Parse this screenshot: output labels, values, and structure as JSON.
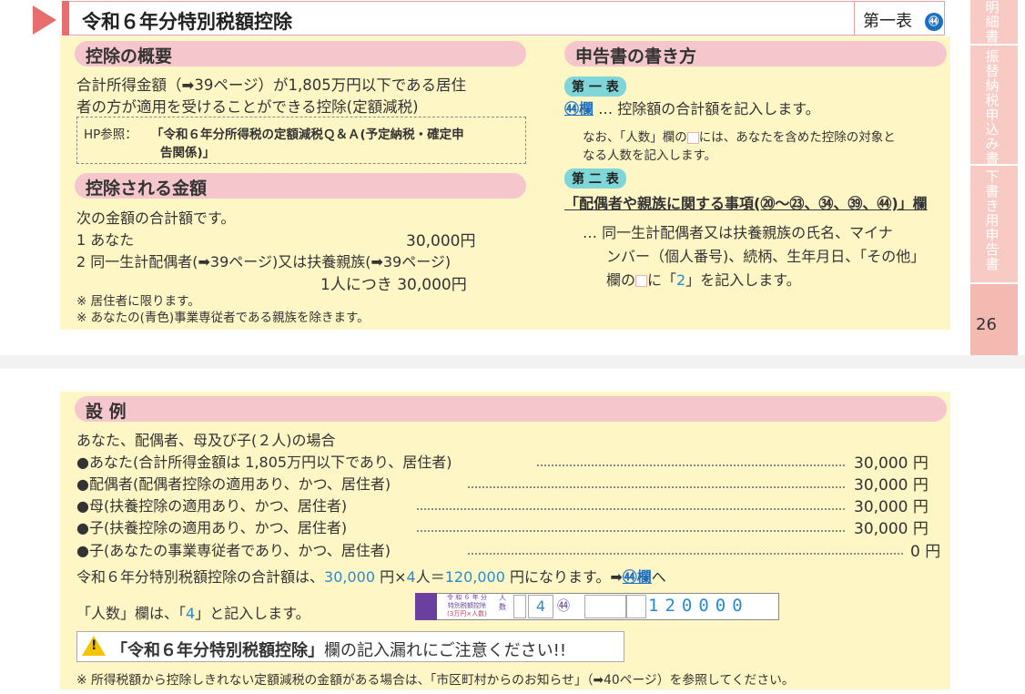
{
  "top": {
    "title": "令和６年分特別税額控除",
    "title_right": "第一表",
    "title_right_num": "㊹",
    "left": {
      "heading1": "控除の概要",
      "desc_line1": "合計所得金額（➡39ページ）が1,805万円以下である居住",
      "desc_line2": "者の方が適用を受けることができる控除(定額減税)",
      "hp_prefix": "HP参照：",
      "hp_title_line1": "「令和６年分所得税の定額減税Ｑ＆Ａ(予定納税・確定申",
      "hp_title_line2": "告関係)」",
      "heading2": "控除される金額",
      "amount_intro": "次の金額の合計額です。",
      "item1_label": "1  あなた",
      "item1_value": "30,000円",
      "item2_label": "2  同一生計配偶者(➡39ページ)又は扶養親族(➡39ページ)",
      "item2_value": "1人につき  30,000円",
      "note1": "※ 居住者に限ります。",
      "note2": "※ あなたの(青色)事業専従者である親族を除きます。"
    },
    "right": {
      "heading": "申告書の書き方",
      "badge1": "第 一 表",
      "line1_num": "㊹欄",
      "line1_text": "… 控除額の合計額を記入します。",
      "line2": "なお、「人数」欄の",
      "line2b": "には、あなたを含めた控除の対象と",
      "line3": "なる人数を記入します。",
      "badge2": "第 二 表",
      "line4": "「配偶者や親族に関する事項(⑳～㉓、㉞、㊴、㊹)」欄",
      "line5": "… 同一生計配偶者又は扶養親族の氏名、マイナ",
      "line6": "ンバー（個人番号)、続柄、生年月日、「その他」",
      "line7a": "欄の",
      "line7b": "に「",
      "line7c": "2",
      "line7d": "」を記入します。"
    },
    "side_tabs": [
      "明細書",
      "振替納税申込み書",
      "下書き用申告書"
    ],
    "page_number": "26"
  },
  "bottom": {
    "heading": "設    例",
    "intro": "あなた、配偶者、母及び子(２人)の場合",
    "rows": [
      {
        "label": "●あなた(合計所得金額は 1,805万円以下であり、居住者)",
        "value": "30,000 円"
      },
      {
        "label": "●配偶者(配偶者控除の適用あり、かつ、居住者)",
        "value": "30,000 円"
      },
      {
        "label": "●母(扶養控除の適用あり、かつ、居住者)",
        "value": "30,000 円"
      },
      {
        "label": "●子(扶養控除の適用あり、かつ、居住者)",
        "value": "30,000 円"
      },
      {
        "label": "●子(あなたの事業専従者であり、かつ、居住者)",
        "value": "0 円"
      }
    ],
    "total_prefix": "令和６年分特別税額控除の合計額は、",
    "total_a": "30,000",
    "total_b": " 円×",
    "total_c": "4",
    "total_d": "人＝",
    "total_e": "120,000",
    "total_f": " 円になります。➡",
    "total_g": "㊹欄",
    "total_h": "へ",
    "ninzu_a": "「人数」欄は、「",
    "ninzu_b": "4",
    "ninzu_c": "」と記入します。",
    "form_label_line1": "令 和 ６ 年 分",
    "form_label_line2": "特別税額控除",
    "form_label_line3": "(3万円×人数)",
    "form_ninzu_label": "人数",
    "form_ninzu_value": "4",
    "form_num": "㊹",
    "form_amount": "120000",
    "warn_bold": "「令和６年分特別税額控除」",
    "warn_rest": "欄の記入漏れにご注意ください!!",
    "footnote": "※ 所得税額から控除しきれない定額減税の金額がある場合は、「市区町村からのお知らせ」（➡40ページ）を参照してください。"
  },
  "colors": {
    "pink_bar": "#f5c7cd",
    "yellow_bg": "#fff6c6",
    "blue": "#2a8bd0",
    "side_tab": "#f4b9b0",
    "teal_badge": "#7ed6d8"
  }
}
